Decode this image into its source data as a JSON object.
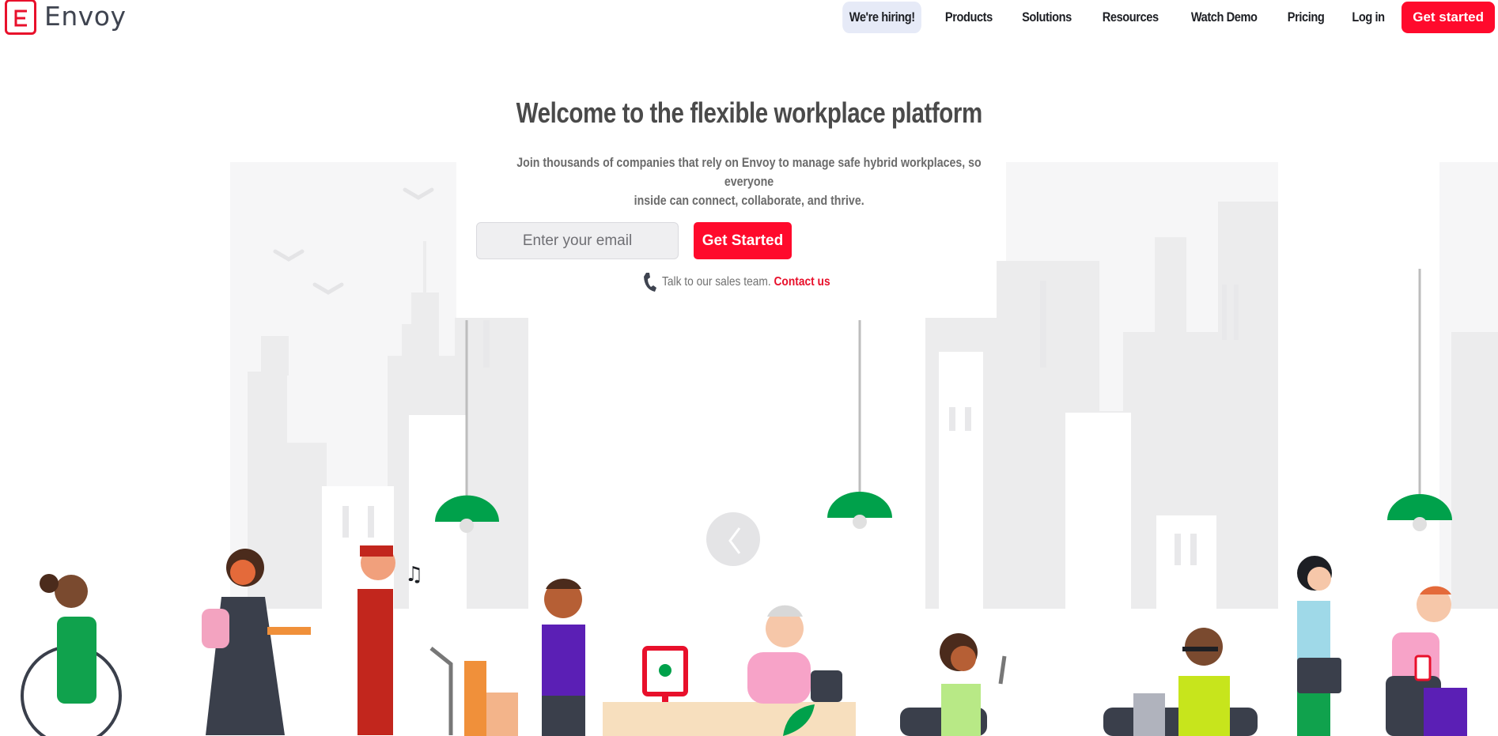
{
  "brand": {
    "name": "Envoy",
    "logo_letter": "E"
  },
  "nav": {
    "items": [
      {
        "label": "We're hiring!"
      },
      {
        "label": "Products"
      },
      {
        "label": "Solutions"
      },
      {
        "label": "Resources"
      },
      {
        "label": "Watch Demo"
      },
      {
        "label": "Pricing"
      },
      {
        "label": "Log in"
      }
    ],
    "cta_label": "Get started"
  },
  "hero": {
    "title": "Welcome to the flexible workplace platform",
    "subtitle_line1": "Join thousands of companies that rely on Envoy to manage safe hybrid workplaces, so everyone",
    "subtitle_line2": "inside can connect, collaborate, and thrive.",
    "email_placeholder": "Enter your email",
    "cta_label": "Get Started",
    "sales_text": "Talk to our sales team.",
    "contact_label": "Contact us"
  },
  "colors": {
    "accent": "#ff0a2c",
    "text_dark": "#4a4a4a",
    "lamp_green": "#00a14b",
    "hiring_bg": "#e6eaf7"
  }
}
